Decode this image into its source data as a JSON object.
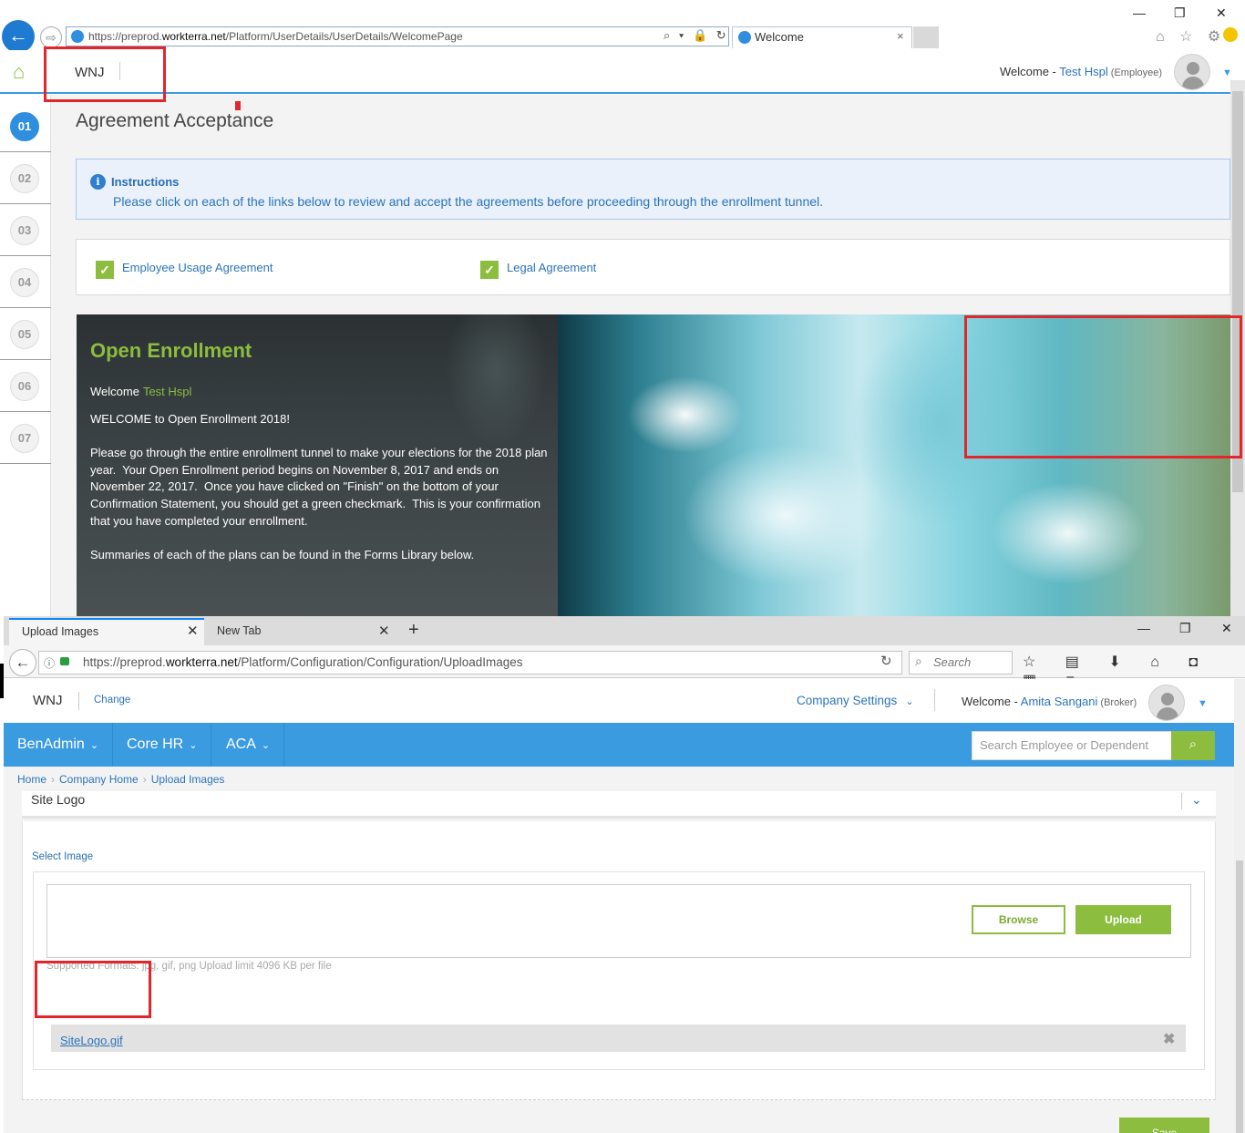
{
  "ie": {
    "url_prefix": "https://preprod.",
    "url_domain": "workterra.net",
    "url_path": "/Platform/UserDetails/UserDetails/WelcomePage",
    "tab_title": "Welcome",
    "tab_close": "×",
    "win_min": "—",
    "win_restore": "❐",
    "win_close": "✕",
    "addr_tools": "⌕ ▾ 🔒 ↻",
    "right_icons": "⌂ ☆ ⚙"
  },
  "app1": {
    "company": "WNJ",
    "welcome_label": "Welcome - ",
    "user_name": "Test Hspl",
    "user_role": " (Employee)",
    "page_title": "Agreement Acceptance",
    "steps": [
      "01",
      "02",
      "03",
      "04",
      "05",
      "06",
      "07"
    ],
    "instructions_icon": "i",
    "instructions_title": "Instructions",
    "instructions_text": "Please click on each of the links below to review and accept the agreements before proceeding through the enrollment tunnel.",
    "agreements": [
      {
        "label": "Employee Usage Agreement",
        "checked": true
      },
      {
        "label": "Legal Agreement",
        "checked": true
      }
    ],
    "check_glyph": "✓",
    "banner": {
      "title": "Open Enrollment",
      "welcome_label": "Welcome",
      "welcome_name": "Test Hspl",
      "body": "WELCOME to Open Enrollment 2018!\n\nPlease go through the entire enrollment tunnel to make your elections for the 2018 plan year.  Your Open Enrollment period begins on November 8, 2017 and ends on November 22, 2017.  Once you have clicked on \"Finish\" on the bottom of your Confirmation Statement, you should get a green checkmark.  This is your confirmation that you have completed your enrollment.\n\nSummaries of each of the plans can be found in the Forms Library below."
    }
  },
  "ff": {
    "tabs": [
      {
        "label": "Upload Images",
        "active": true
      },
      {
        "label": "New Tab",
        "active": false
      }
    ],
    "tab_close": "✕",
    "new_tab": "+",
    "win_min": "—",
    "win_restore": "❐",
    "win_close": "✕",
    "url_prefix": "https://preprod.",
    "url_domain": "workterra.net",
    "url_path": "/Platform/Configuration/Configuration/UploadImages",
    "search_placeholder": "Search",
    "toolbar_icons": "☆ ▤ ⬇ ⌂ ◘ ▦ ≡"
  },
  "app2": {
    "company": "WNJ",
    "change_label": "Change",
    "company_settings": "Company Settings",
    "welcome_label": "Welcome - ",
    "user_name": "Amita Sangani",
    "user_role": " (Broker)",
    "nav": [
      "BenAdmin",
      "Core HR",
      "ACA"
    ],
    "search_placeholder": "Search Employee or Dependent",
    "breadcrumbs": [
      "Home",
      "Company Home",
      "Upload Images"
    ],
    "section_title": "Site Logo",
    "select_image_label": "Select Image",
    "browse_label": "Browse",
    "upload_label": "Upload",
    "formats_text": "Supported Formats: jpg, gif, png Upload limit 4096 KB per file",
    "file_name": "SiteLogo.gif",
    "file_remove": "✖",
    "save_label": "Save"
  },
  "colors": {
    "accent_blue": "#3a9be0",
    "accent_green": "#8cbd3f",
    "link_blue": "#2b74b9",
    "annotation_red": "#e3262b"
  }
}
